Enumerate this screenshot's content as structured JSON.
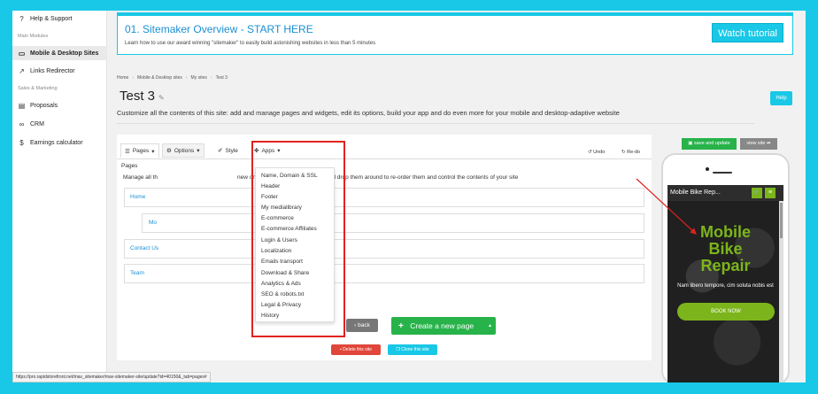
{
  "sidebar": {
    "help_support": "Help & Support",
    "section_main": "Main Modules",
    "mobile_desktop": "Mobile & Desktop Sites",
    "links_redirector": "Links Redirector",
    "section_sales": "Sales & Marketing",
    "proposals": "Proposals",
    "crm": "CRM",
    "earnings": "Earnings calculator"
  },
  "banner": {
    "title": "01. Sitemaker Overview - START HERE",
    "subtitle": "Learn how to use our award winning \"sitemaker\" to easily build astonishing websites in less than 5 minutes",
    "watch_label": "Watch tutorial"
  },
  "breadcrumb": [
    "Home",
    "Mobile & Desktop sites",
    "My sites",
    "Test 3"
  ],
  "page": {
    "title": "Test 3",
    "help_label": "Help",
    "description": "Customize all the contents of this site: add and manage pages and widgets, edit its options, build your app and do even more for your mobile and desktop-adaptive website"
  },
  "tabs": {
    "pages": "Pages",
    "options": "Options",
    "style": "Style",
    "apps": "Apps",
    "undo": "Undo",
    "redo": "Re-do"
  },
  "pages_panel": {
    "label": "Pages",
    "manage_prefix": "Manage all th",
    "manage_suffix": "new ones, edit existing ones, drag and drop them around to re-order them and control the contents of your site",
    "rows": [
      "Home",
      "Mo",
      "Contact Us",
      "Team"
    ]
  },
  "options_menu": [
    "Name, Domain & SSL",
    "Header",
    "Footer",
    "My medialibrary",
    "E-commerce",
    "E-commerce Affiliates",
    "Login & Users",
    "Localization",
    "Emails transport",
    "Download & Share",
    "Analytics & Ads",
    "SEO & robots.txt",
    "Legal & Privacy",
    "History"
  ],
  "actions": {
    "back": "back",
    "create_page": "Create a new page",
    "delete_site": "Delete this site",
    "clone_site": "Clone this site",
    "save_update": "save and update",
    "view_site": "view site"
  },
  "phone_preview": {
    "site_title": "Mobile Bike Rep...",
    "hero_lines": [
      "Mobile",
      "Bike",
      "Repair"
    ],
    "hero_sub": "Nam libero tempore, cim soluta nobis est",
    "book_now": "BOOK NOW"
  },
  "status_url": "https://pro.rapidstorefront.net/mav_sitemaker/mav-sitemaker-site/update?id=40150&_tab=pages#",
  "colors": {
    "accent": "#18c8e6",
    "link_blue": "#1b8fd4",
    "green": "#27b34a",
    "site_green": "#7cb51b",
    "highlight_red": "#e0231e"
  }
}
